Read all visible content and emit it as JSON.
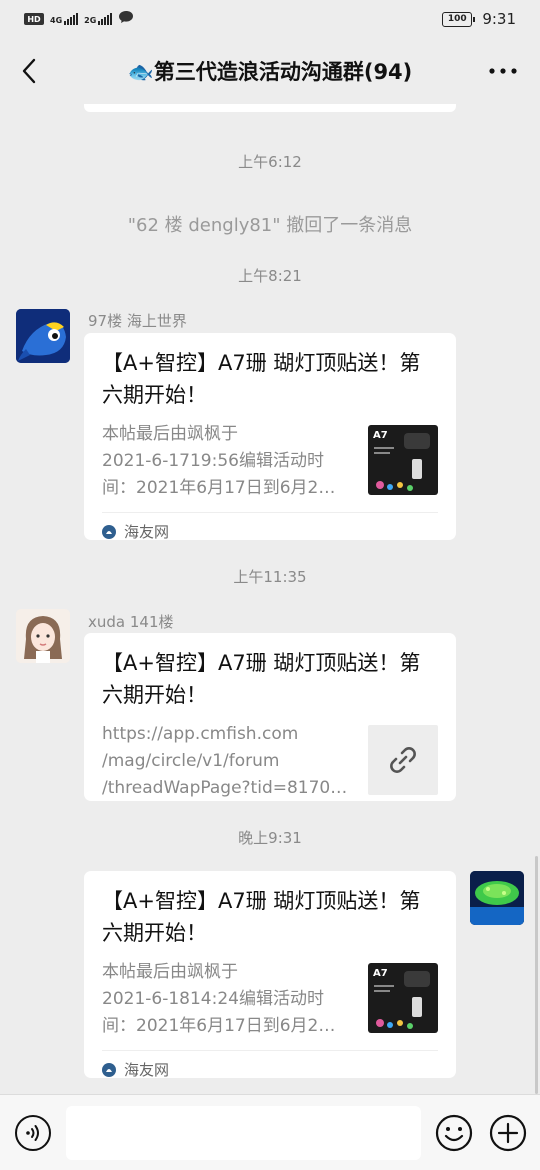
{
  "status_bar": {
    "left_icons": [
      "HD",
      "4G",
      "2G",
      "message-bubble"
    ],
    "signal_1_label": "4G",
    "signal_2_label": "2G",
    "battery": "100",
    "time": "9:31"
  },
  "header": {
    "title": "🐟第三代造浪活动沟通群(94)",
    "back_icon": "chevron-left-icon",
    "more_icon": "more-horizontal-icon",
    "more_label": "•••"
  },
  "messages": {
    "ts1": "上午6:12",
    "recall": "\"62 楼 dengly81\" 撤回了一条消息",
    "ts2": "上午8:21",
    "m1": {
      "sender": "97楼  海上世界",
      "title": "【A+智控】A7珊 瑚灯顶贴送！第六期开始！",
      "desc_l1": "本帖最后由飒枫于",
      "desc_l2": "2021-6-1719:56编辑活动时",
      "desc_l3": "间：2021年6月17日到6月2…",
      "thumb_label": "A7",
      "source": "海友网"
    },
    "ts3": "上午11:35",
    "m2": {
      "sender": "xuda 141楼",
      "title": "【A+智控】A7珊 瑚灯顶贴送！第六期开始！",
      "desc_l1": "https://app.cmfish.com",
      "desc_l2": "/mag/circle/v1/forum",
      "desc_l3": "/threadWapPage?tid=8170…"
    },
    "ts4": "晚上9:31",
    "m3": {
      "title": "【A+智控】A7珊 瑚灯顶贴送！第六期开始！",
      "desc_l1": "本帖最后由飒枫于",
      "desc_l2": "2021-6-1814:24编辑活动时",
      "desc_l3": "间：2021年6月17日到6月2…",
      "thumb_label": "A7",
      "source": "海友网"
    }
  },
  "input_bar": {
    "placeholder": "",
    "voice_icon": "voice-icon",
    "emoji_icon": "emoji-icon",
    "plus_icon": "plus-icon"
  }
}
